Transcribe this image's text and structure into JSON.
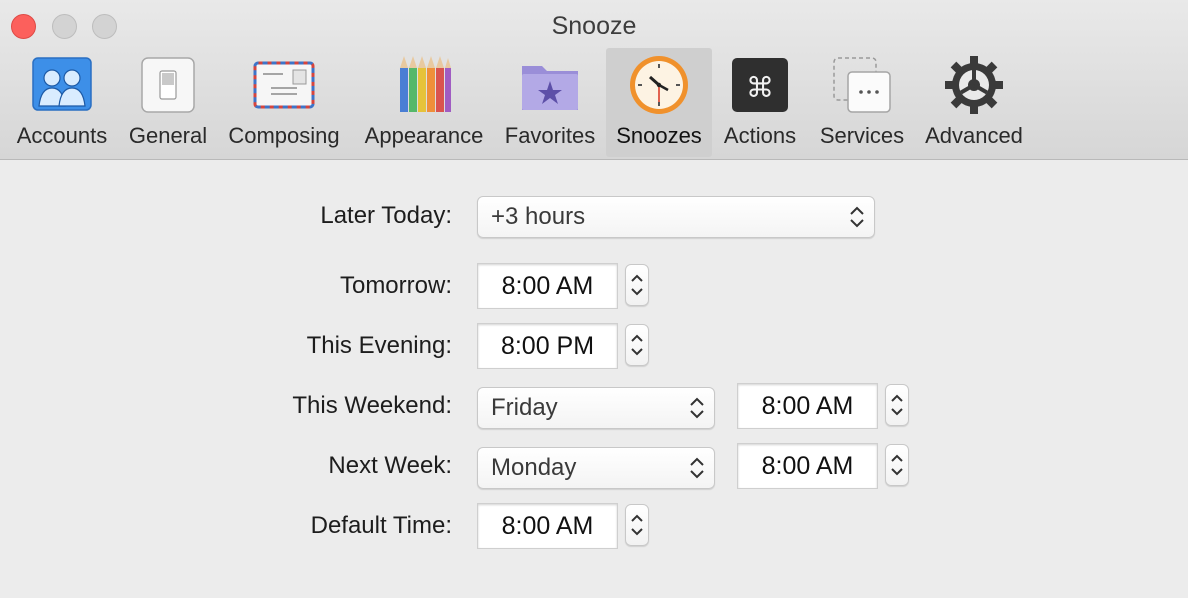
{
  "window": {
    "title": "Snooze"
  },
  "toolbar": {
    "items": [
      {
        "label": "Accounts",
        "icon": "accounts-icon"
      },
      {
        "label": "General",
        "icon": "general-switch-icon"
      },
      {
        "label": "Composing",
        "icon": "envelope-icon"
      },
      {
        "label": "Appearance",
        "icon": "colored-pencils-icon"
      },
      {
        "label": "Favorites",
        "icon": "star-folder-icon"
      },
      {
        "label": "Snoozes",
        "icon": "clock-icon",
        "selected": true
      },
      {
        "label": "Actions",
        "icon": "command-key-icon"
      },
      {
        "label": "Services",
        "icon": "services-icon"
      },
      {
        "label": "Advanced",
        "icon": "gear-icon"
      }
    ]
  },
  "form": {
    "later_today": {
      "label": "Later Today:",
      "value": "+3 hours"
    },
    "tomorrow": {
      "label": "Tomorrow:",
      "time": "8:00 AM"
    },
    "this_evening": {
      "label": "This Evening:",
      "time": "8:00 PM"
    },
    "this_weekend": {
      "label": "This Weekend:",
      "day": "Friday",
      "time": "8:00 AM"
    },
    "next_week": {
      "label": "Next Week:",
      "day": "Monday",
      "time": "8:00 AM"
    },
    "default_time": {
      "label": "Default Time:",
      "time": "8:00 AM"
    }
  },
  "colors": {
    "close_button": "#fc605c",
    "accent_blue": "#3d8fe8",
    "clock_orange": "#f0912c"
  }
}
